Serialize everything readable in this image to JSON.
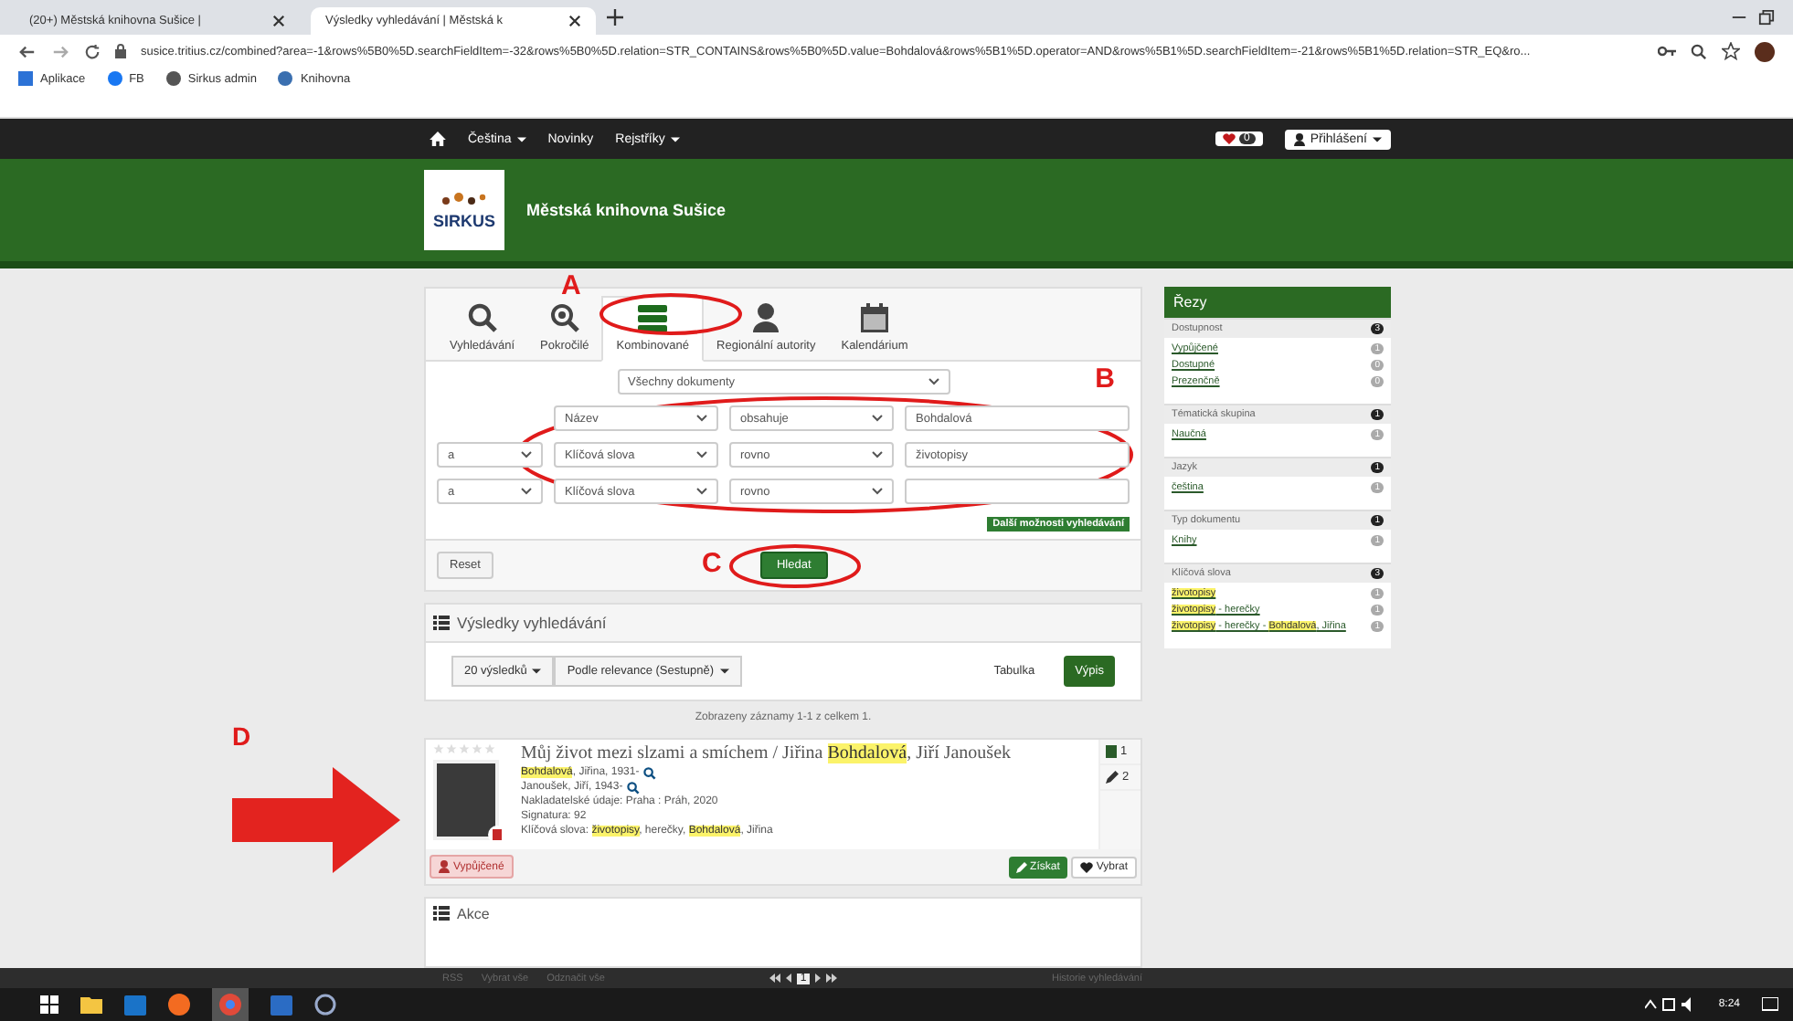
{
  "browser": {
    "tabs": [
      {
        "title": "(20+) Městská knihovna Sušice |",
        "selected": false
      },
      {
        "title": "Výsledky vyhledávání | Městská k",
        "selected": true
      }
    ],
    "url": "susice.tritius.cz/combined?area=-1&rows%5B0%5D.searchFieldItem=-32&rows%5B0%5D.relation=STR_CONTAINS&rows%5B0%5D.value=Bohdalová&rows%5B1%5D.operator=AND&rows%5B1%5D.searchFieldItem=-21&rows%5B1%5D.relation=STR_EQ&ro...",
    "bookmarks": [
      "Aplikace",
      "FB",
      "Sirkus admin",
      "Knihovna"
    ]
  },
  "site_nav": {
    "items": [
      {
        "label": "Čeština",
        "dropdown": true
      },
      {
        "label": "Novinky",
        "dropdown": false
      },
      {
        "label": "Rejstříky",
        "dropdown": true
      }
    ],
    "favorites_count": "0",
    "login": "Přihlášení"
  },
  "header": {
    "logo_text": "SIRKUS",
    "title": "Městská knihovna Sušice"
  },
  "search": {
    "tabs": [
      {
        "label": "Vyhledávání",
        "kind": "search",
        "selected": false
      },
      {
        "label": "Pokročilé",
        "kind": "advanced",
        "selected": false
      },
      {
        "label": "Kombinované",
        "kind": "combined",
        "selected": true
      },
      {
        "label": "Regionální autority",
        "kind": "person",
        "selected": false
      },
      {
        "label": "Kalendárium",
        "kind": "calendar",
        "selected": false
      }
    ],
    "tabs_annotation": "A",
    "document_type": "Všechny dokumenty",
    "rows_annotation": "B",
    "rows": [
      {
        "field": "Název",
        "relation": "obsahuje",
        "value": "Bohdalová"
      },
      {
        "operator": "a",
        "field": "Klíčová slova",
        "relation": "rovno",
        "value": "životopisy"
      },
      {
        "operator": "a",
        "field": "Klíčová slova",
        "relation": "rovno"
      }
    ],
    "more_options": "Další možnosti vyhledávání",
    "reset": "Reset",
    "submit": "Hledat",
    "submit_annotation": "C"
  },
  "results": {
    "title": "Výsledky vyhledávání",
    "page_size": "20 výsledků",
    "sort": "Podle relevance (Sestupně)",
    "views": [
      {
        "label": "Tabulka",
        "selected": false
      },
      {
        "label": "Výpis",
        "selected": true
      }
    ],
    "summary": "Zobrazeny záznamy 1-1 z celkem 1.",
    "records": [
      {
        "annotation": "D",
        "stars": 0,
        "title": [
          {
            "text": "Můj život mezi slzami a smíchem / Jiřina ",
            "highlight": false
          },
          {
            "text": "Bohdalová",
            "highlight": true
          },
          {
            "text": ", Jiří Janoušek",
            "highlight": false
          }
        ],
        "lines": [
          [
            {
              "text": "Bohdalová",
              "highlight": true
            },
            {
              "text": ", Jiřina, 1931-",
              "highlight": false
            }
          ],
          [
            {
              "text": "Janoušek, Jiří, 1943-",
              "highlight": false
            }
          ],
          [
            {
              "text": "Nakladatelské údaje: Praha : Práh, 2020",
              "highlight": false
            }
          ],
          [
            {
              "text": "Signatura: 92",
              "highlight": false
            }
          ],
          [
            {
              "text": "Klíčová slova: ",
              "highlight": false
            },
            {
              "text": "životopisy",
              "highlight": true
            },
            {
              "text": ", herečky, ",
              "highlight": false
            },
            {
              "text": "Bohdalová",
              "highlight": true
            },
            {
              "text": ", Jiřina",
              "highlight": false
            }
          ]
        ],
        "line_search": [
          true,
          true,
          false,
          false,
          false
        ],
        "copies": "1",
        "reviews": "2",
        "status": "Vypůjčené",
        "get": "Získat",
        "pick": "Vybrat"
      }
    ],
    "actions_title": "Akce"
  },
  "footer": {
    "links": [
      "RSS",
      "Vybrat vše",
      "Odznačit vše"
    ],
    "page": "1",
    "history": "Historie vyhledávání"
  },
  "facets": {
    "title": "Řezy",
    "groups": [
      {
        "title": "Dostupnost",
        "count": "3",
        "items": [
          {
            "label": [
              {
                "text": "Vypůjčené",
                "highlight": false
              }
            ],
            "count": "1"
          },
          {
            "label": [
              {
                "text": "Dostupné",
                "highlight": false
              }
            ],
            "count": "0"
          },
          {
            "label": [
              {
                "text": "Prezenčně",
                "highlight": false
              }
            ],
            "count": "0"
          }
        ]
      },
      {
        "title": "Tématická skupina",
        "count": "1",
        "items": [
          {
            "label": [
              {
                "text": "Naučná",
                "highlight": false
              }
            ],
            "count": "1"
          }
        ]
      },
      {
        "title": "Jazyk",
        "count": "1",
        "items": [
          {
            "label": [
              {
                "text": "čeština",
                "highlight": false
              }
            ],
            "count": "1"
          }
        ]
      },
      {
        "title": "Typ dokumentu",
        "count": "1",
        "items": [
          {
            "label": [
              {
                "text": "Knihy",
                "highlight": false
              }
            ],
            "count": "1"
          }
        ]
      },
      {
        "title": "Klíčová slova",
        "count": "3",
        "items": [
          {
            "label": [
              {
                "text": "životopisy",
                "highlight": true
              }
            ],
            "count": "1"
          },
          {
            "label": [
              {
                "text": "životopisy",
                "highlight": true
              },
              {
                "text": " - herečky",
                "highlight": false
              }
            ],
            "count": "1"
          },
          {
            "label": [
              {
                "text": "životopisy",
                "highlight": true
              },
              {
                "text": " - herečky - ",
                "highlight": false
              },
              {
                "text": "Bohdalová",
                "highlight": true
              },
              {
                "text": ", Jiřina",
                "highlight": false
              }
            ],
            "count": "1"
          }
        ]
      }
    ]
  },
  "taskbar": {
    "time": "8:24"
  }
}
